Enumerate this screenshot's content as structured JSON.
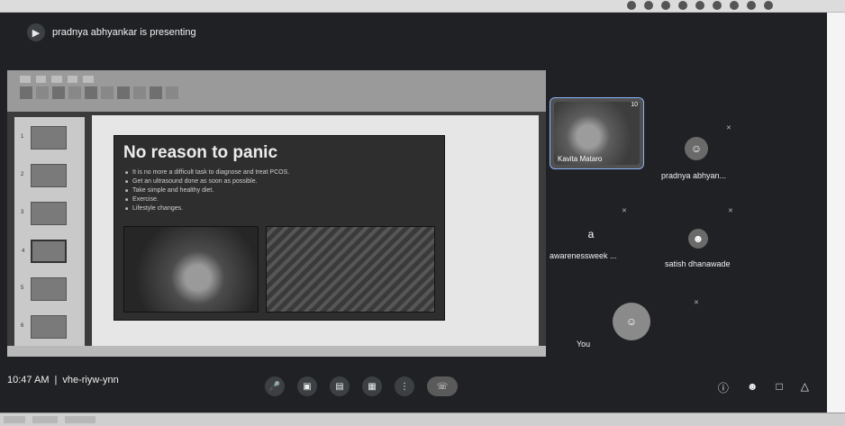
{
  "meeting": {
    "presenter_banner": "pradnya abhyankar is presenting",
    "time": "10:47 AM",
    "separator": "|",
    "code": "vhe-riyw-ynn"
  },
  "slide": {
    "title": "No reason to panic",
    "bullets": [
      "It is no more a difficult task to diagnose and treat PCOS.",
      "Get an ultrasound done as soon as possible.",
      "Take simple and healthy diet.",
      "Exercise.",
      "Lifestyle changes."
    ],
    "thumbnail_numbers": [
      "1",
      "2",
      "3",
      "4",
      "5",
      "6"
    ]
  },
  "participants": {
    "kavita": {
      "name": "Kavita Mataro",
      "badge": "10"
    },
    "pradnya": {
      "name": "pradnya abhyan..."
    },
    "awareness": {
      "initial": "a",
      "name": "awarenessweek ..."
    },
    "satish": {
      "name": "satish dhanawade"
    },
    "you": {
      "name": "You"
    }
  },
  "icons": {
    "mic_off": "mic-off-icon",
    "camera_off": "camera-off-icon",
    "captions": "captions-icon",
    "present": "present-icon",
    "more": "more-options-icon",
    "leave": "leave-call-icon",
    "info": "info-icon",
    "people": "people-icon",
    "chat": "chat-icon",
    "activities": "activities-icon"
  }
}
